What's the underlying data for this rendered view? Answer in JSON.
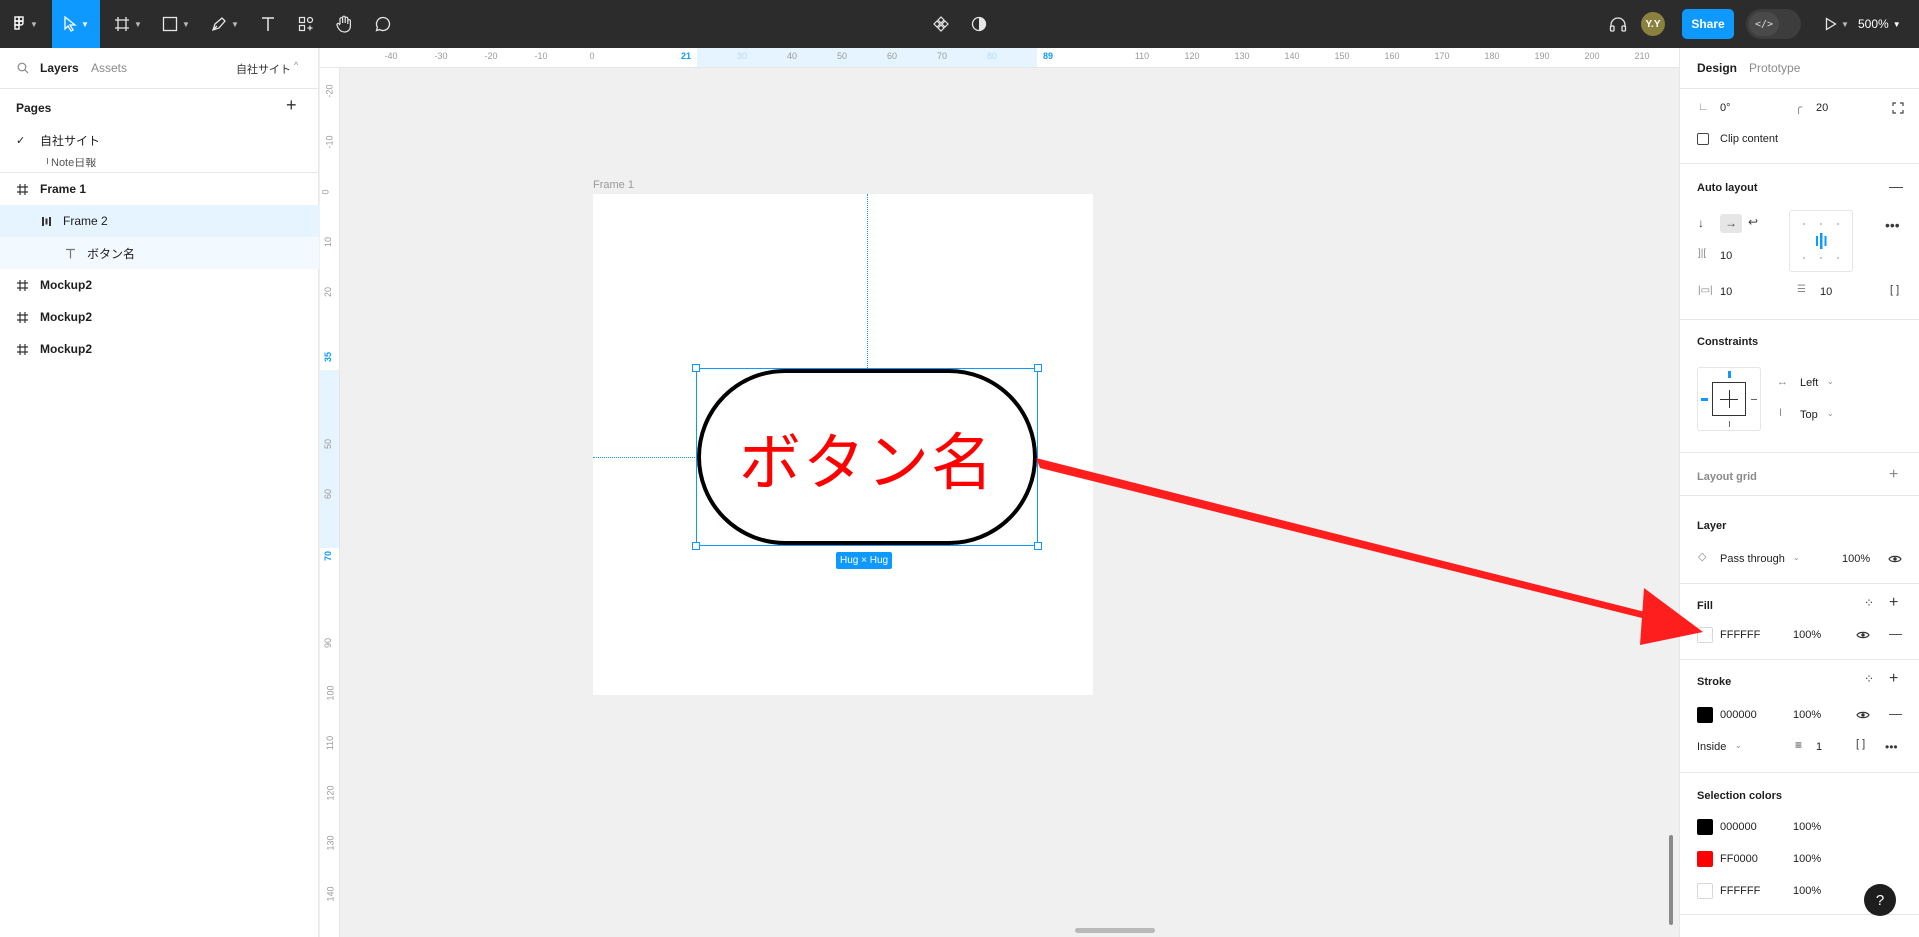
{
  "toolbar": {
    "avatar_initials": "Y.Y",
    "share_label": "Share",
    "devmode_symbol": "</>",
    "zoom_label": "500%"
  },
  "left_panel": {
    "tabs": [
      "Layers",
      "Assets"
    ],
    "file_name": "自社サイト",
    "pages_title": "Pages",
    "pages": [
      {
        "label": "自社サイト",
        "current": true
      },
      {
        "label": "「Note日報"
      }
    ],
    "layers": [
      {
        "label": "Frame 1",
        "icon": "frame-icon"
      },
      {
        "label": "Frame 2",
        "icon": "autolayout-icon"
      },
      {
        "label": "ボタン名",
        "icon": "text-icon"
      },
      {
        "label": "Mockup2",
        "icon": "frame-icon"
      },
      {
        "label": "Mockup2",
        "icon": "frame-icon"
      },
      {
        "label": "Mockup2",
        "icon": "frame-icon"
      }
    ]
  },
  "rulers": {
    "top": [
      "-40",
      "-30",
      "-20",
      "-10",
      "0",
      "21",
      "30",
      "40",
      "50",
      "60",
      "70",
      "80",
      "89",
      "110",
      "120",
      "130",
      "140",
      "150",
      "160",
      "170",
      "180",
      "190",
      "200",
      "210"
    ],
    "left": [
      "-20",
      "-10",
      "0",
      "10",
      "20",
      "35",
      "50",
      "60",
      "70",
      "90",
      "100",
      "110",
      "120",
      "130",
      "140"
    ]
  },
  "canvas": {
    "frame_label": "Frame 1",
    "button_text": "ボタン名",
    "size_badge": "Hug × Hug",
    "arrow_color": "#ff1e1e"
  },
  "right_panel": {
    "tabs": [
      "Design",
      "Prototype"
    ],
    "rotation": "0°",
    "radius": "20",
    "clip_content": "Clip content",
    "auto_layout": {
      "title": "Auto layout",
      "gap": "10",
      "padding_h": "10",
      "padding_v": "10"
    },
    "constraints": {
      "title": "Constraints",
      "horizontal": "Left",
      "vertical": "Top"
    },
    "layout_grid": "Layout grid",
    "layer": {
      "title": "Layer",
      "blend": "Pass through",
      "opacity": "100%"
    },
    "fill": {
      "title": "Fill",
      "hex": "FFFFFF",
      "opacity": "100%",
      "color": "#ffffff"
    },
    "stroke": {
      "title": "Stroke",
      "hex": "000000",
      "opacity": "100%",
      "color": "#000000",
      "position": "Inside",
      "weight": "1"
    },
    "selection_colors": {
      "title": "Selection colors",
      "items": [
        {
          "hex": "000000",
          "opacity": "100%",
          "color": "#000000"
        },
        {
          "hex": "FF0000",
          "opacity": "100%",
          "color": "#ff0000"
        },
        {
          "hex": "FFFFFF",
          "opacity": "100%",
          "color": "#ffffff"
        }
      ]
    },
    "help": "?"
  }
}
